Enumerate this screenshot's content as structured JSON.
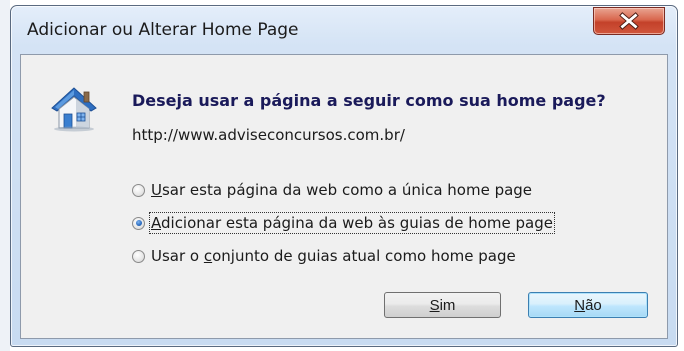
{
  "window": {
    "title": "Adicionar ou Alterar Home Page",
    "close_icon": "close-x-icon"
  },
  "dialog": {
    "icon": "home-page-icon",
    "question": "Deseja usar a página a seguir como sua home page?",
    "url": "http://www.adviseconcursos.com.br/",
    "options": [
      {
        "prefix": "",
        "accel": "U",
        "rest": "sar esta página da web como a única home page",
        "checked": false
      },
      {
        "prefix": "",
        "accel": "A",
        "rest": "dicionar esta página da web às guias de home page",
        "checked": true
      },
      {
        "prefix": "Usar o ",
        "accel": "c",
        "rest": "onjunto de guias atual como home page",
        "checked": false
      }
    ],
    "selected_index": 1
  },
  "buttons": {
    "yes": {
      "accel": "S",
      "rest": "im"
    },
    "no": {
      "accel": "N",
      "rest": "ão"
    }
  },
  "colors": {
    "frame": "#c8dbf1",
    "close_button": "#c4412a",
    "question_text": "#1a1a5a",
    "default_button_border": "#3c7fb1"
  }
}
